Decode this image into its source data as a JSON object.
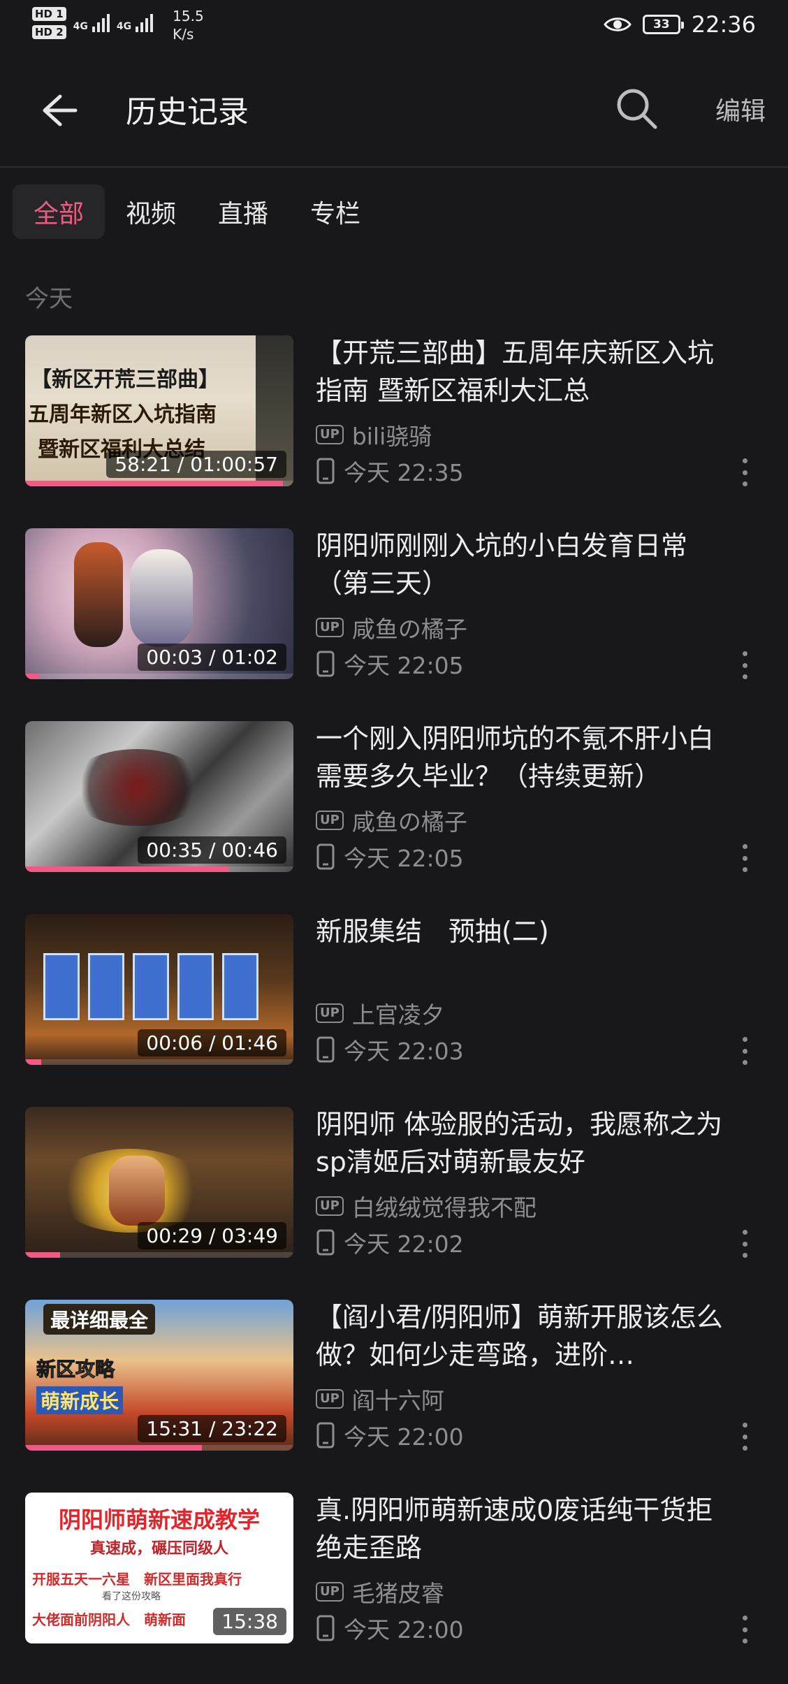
{
  "status_bar": {
    "sim1": "HD 1",
    "sim2": "HD 2",
    "network1": "4G",
    "network2": "4G",
    "speed_value": "15.5",
    "speed_unit": "K/s",
    "battery": "33",
    "time": "22:36",
    "icons": [
      "eye-icon",
      "battery-icon"
    ]
  },
  "header": {
    "title": "历史记录",
    "edit_label": "编辑",
    "icons": [
      "arrow-left-icon",
      "search-icon"
    ]
  },
  "tabs": [
    {
      "label": "全部",
      "active": true
    },
    {
      "label": "视频",
      "active": false
    },
    {
      "label": "直播",
      "active": false
    },
    {
      "label": "专栏",
      "active": false
    }
  ],
  "section": {
    "label": "今天"
  },
  "items": [
    {
      "title": "【开荒三部曲】五周年庆新区入坑指南 暨新区福利大汇总",
      "uploader": "bili骁骑",
      "time": "今天 22:35",
      "duration": "58:21 / 01:00:57",
      "progress": 0.96,
      "thumb_text": [
        "【新区开荒三部曲】",
        "五周年新区入坑指南",
        "暨新区福利大总结"
      ]
    },
    {
      "title": "阴阳师刚刚入坑的小白发育日常（第三天）",
      "uploader": "咸鱼の橘子",
      "time": "今天 22:05",
      "duration": "00:03 / 01:02",
      "progress": 0.05,
      "thumb_text": []
    },
    {
      "title": "一个刚入阴阳师坑的不氪不肝小白需要多久毕业？（持续更新）",
      "uploader": "咸鱼の橘子",
      "time": "今天 22:05",
      "duration": "00:35 / 00:46",
      "progress": 0.76,
      "thumb_text": []
    },
    {
      "title": "新服集结　预抽(二)",
      "uploader": "上官凌夕",
      "time": "今天 22:03",
      "duration": "00:06 / 01:46",
      "progress": 0.06,
      "thumb_text": []
    },
    {
      "title": "阴阳师  体验服的活动，我愿称之为sp清姬后对萌新最友好",
      "uploader": "白绒绒觉得我不配",
      "time": "今天 22:02",
      "duration": "00:29 / 03:49",
      "progress": 0.13,
      "thumb_text": []
    },
    {
      "title": "【阎小君/阴阳师】萌新开服该怎么做？如何少走弯路，进阶…",
      "uploader": "阎十六阿",
      "time": "今天 22:00",
      "duration": "15:31 / 23:22",
      "progress": 0.66,
      "thumb_text": [
        "最详细最全",
        "新区攻略",
        "萌新成长"
      ]
    },
    {
      "title": "真.阴阳师萌新速成0废话纯干货拒绝走歪路",
      "uploader": "毛猪皮睿",
      "time": "今天 22:00",
      "duration": "15:38",
      "progress": 0,
      "thumb_text": [
        "阴阳师萌新速成教学",
        "真速成，碾压同级人",
        "开服五天一六星　新区里面我真行",
        "看了这份攻略",
        "大佬面前阴阳人　萌新面"
      ]
    }
  ],
  "labels": {
    "up_badge": "UP"
  },
  "colors": {
    "accent": "#ee5b85",
    "background": "#18181a",
    "secondary_text": "#8d8d92"
  }
}
